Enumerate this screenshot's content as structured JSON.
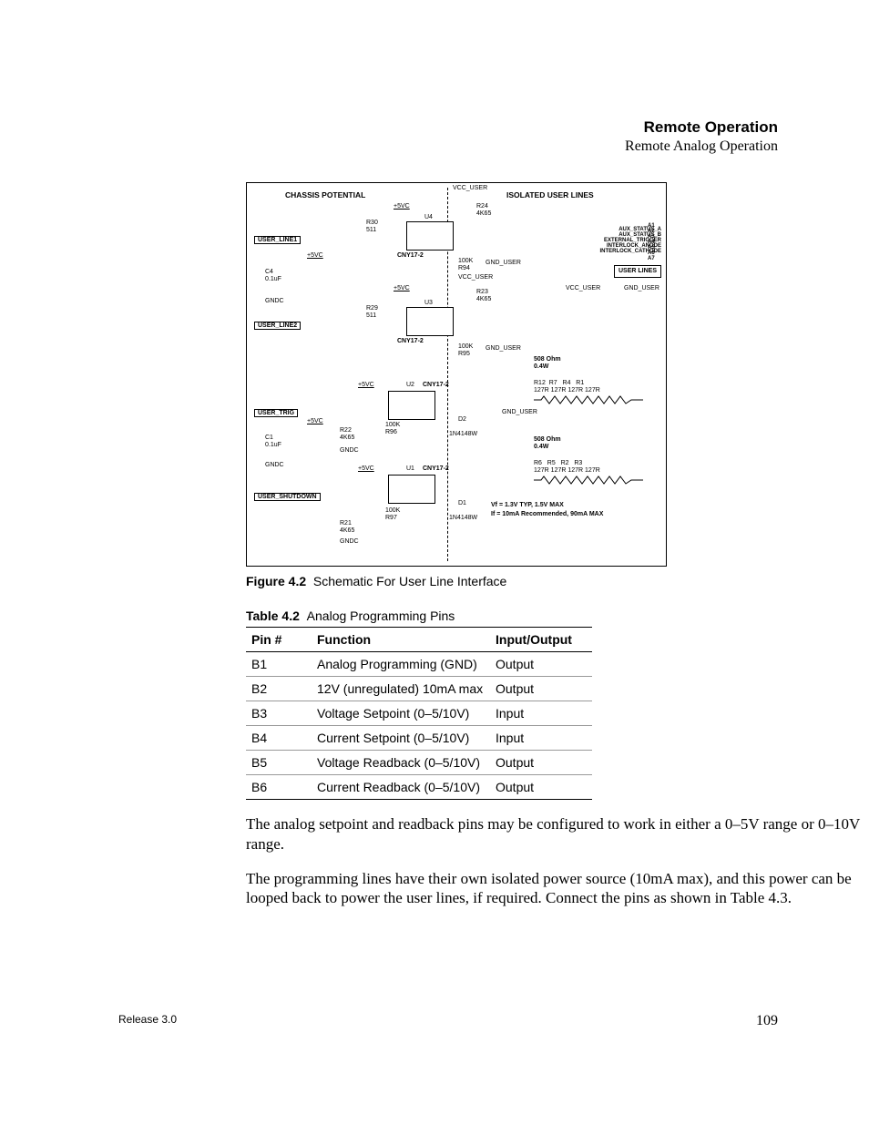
{
  "header": {
    "title": "Remote Operation",
    "sub": "Remote Analog Operation"
  },
  "schematic": {
    "chassis_potential": "CHASSIS POTENTIAL",
    "isolated_user_lines": "ISOLATED USER LINES",
    "vcc_user": "VCC_USER",
    "gnd_user": "GND_USER",
    "plus5vc": "+5VC",
    "gndc": "GNDC",
    "user_line1": "USER_LINE1",
    "user_line2": "USER_LINE2",
    "user_trig": "USER_TRIG",
    "user_shutdown": "USER_SHUTDOWN",
    "user_lines_box": "USER LINES",
    "r30": "R30",
    "r30v": "511",
    "r29": "R29",
    "r29v": "511",
    "r24": "R24",
    "r24v": "4K65",
    "r23": "R23",
    "r23v": "4K65",
    "r94": "R94",
    "r95": "R95",
    "r96": "R96",
    "r97": "R97",
    "r100k": "100K",
    "r22": "R22",
    "r22v": "4K65",
    "r21": "R21",
    "r21v": "4K65",
    "c4": "C4",
    "c4v": "0.1uF",
    "c1": "C1",
    "c1v": "0.1uF",
    "u1": "U1",
    "u2": "U2",
    "u3": "U3",
    "u4": "U4",
    "cny": "CNY17-2",
    "d1": "D1",
    "d2": "D2",
    "d1n": "1N4148W",
    "aux_status": "AUX_STATUS_A",
    "aux_status_b": "AUX_STATUS_B",
    "ext_trig": "EXTERNAL_TRIGGER",
    "interlock_anode": "INTERLOCK_ANODE",
    "interlock_cathode": "INTERLOCK_CATHODE",
    "a1": "A1",
    "a2": "A2",
    "a3": "A3",
    "a4": "A4",
    "a5": "A5",
    "a6": "A6",
    "a7": "A7",
    "r_array1": "R12  R7   R4   R1",
    "r_array1v": "127R 127R 127R 127R",
    "r_array2": "R6   R5   R2   R3",
    "r_array2v": "127R 127R 127R 127R",
    "r508": "508 Ohm",
    "r508w": "0.4W",
    "vf": "Vf = 1.3V TYP, 1.5V MAX",
    "if": "If = 10mA Recommended, 90mA MAX"
  },
  "figure_caption": {
    "label": "Figure 4.2",
    "text": "Schematic For User Line Interface"
  },
  "table_caption": {
    "label": "Table 4.2",
    "text": "Analog Programming Pins"
  },
  "table": {
    "headers": {
      "pin": "Pin #",
      "func": "Function",
      "io": "Input/Output"
    },
    "rows": [
      {
        "pin": "B1",
        "func": "Analog Programming (GND)",
        "io": "Output"
      },
      {
        "pin": "B2",
        "func": "12V (unregulated) 10mA max",
        "io": "Output"
      },
      {
        "pin": "B3",
        "func": "Voltage Setpoint (0–5/10V)",
        "io": "Input"
      },
      {
        "pin": "B4",
        "func": "Current Setpoint (0–5/10V)",
        "io": "Input"
      },
      {
        "pin": "B5",
        "func": "Voltage Readback (0–5/10V)",
        "io": "Output"
      },
      {
        "pin": "B6",
        "func": "Current Readback (0–5/10V)",
        "io": "Output"
      }
    ]
  },
  "para1": "The analog setpoint and readback pins may be configured to work in either a 0–5V range or 0–10V range.",
  "para2": "The programming lines have their own isolated power source (10mA max), and this power can be looped back to power the user lines, if required. Connect the pins as shown in Table 4.3.",
  "footer": {
    "release": "Release 3.0",
    "page": "109"
  }
}
